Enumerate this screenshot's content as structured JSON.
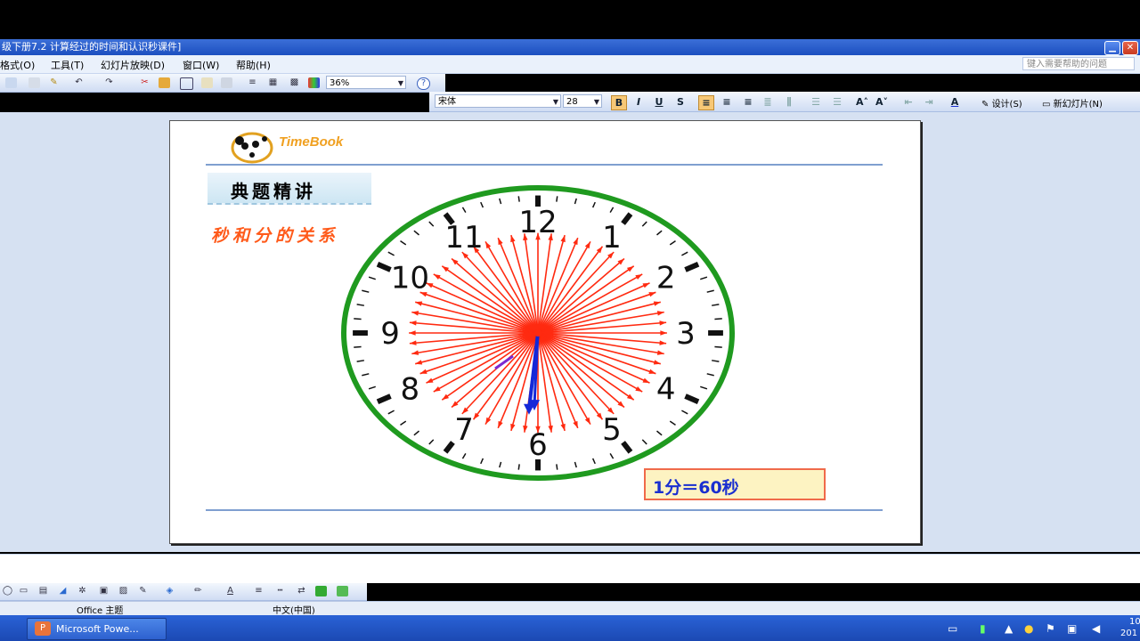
{
  "window": {
    "title": "级下册7.2 计算经过的时间和认识秒课件]"
  },
  "menu": {
    "items": [
      "格式(O)",
      "工具(T)",
      "幻灯片放映(D)",
      "窗口(W)",
      "帮助(H)"
    ],
    "help_placeholder": "键入需要帮助的问题"
  },
  "toolbar": {
    "zoom": "36%",
    "font_name": "宋体",
    "font_size": "28",
    "bold": "B",
    "italic": "I",
    "underline": "U",
    "shadow": "S",
    "design": "设计(S)",
    "new_slide": "新幻灯片(N)"
  },
  "slide": {
    "logo_text": "TimeBook",
    "section_title": "典题精讲",
    "subtitle": "秒和分的关系",
    "equation": "1分＝60秒",
    "clock_numbers": [
      "12",
      "1",
      "2",
      "3",
      "4",
      "5",
      "6",
      "7",
      "8",
      "9",
      "10",
      "11"
    ],
    "colors": {
      "rim": "#1f9a1f",
      "arrows": "#ff2a10",
      "hands": "#1428d8",
      "subtitle": "#ff5a1a",
      "equation": "#1a2fd0"
    }
  },
  "statusbar": {
    "theme": "Office 主题",
    "language": "中文(中国)"
  },
  "taskbar": {
    "app": "Microsoft Powe...",
    "clock_line1": "10",
    "clock_line2": "201"
  },
  "icons": [
    "minimize-icon",
    "close-icon",
    "help-icon",
    "bold-icon",
    "align-left-icon",
    "powerpoint-icon",
    "speaker-icon",
    "flag-icon",
    "network-icon"
  ]
}
